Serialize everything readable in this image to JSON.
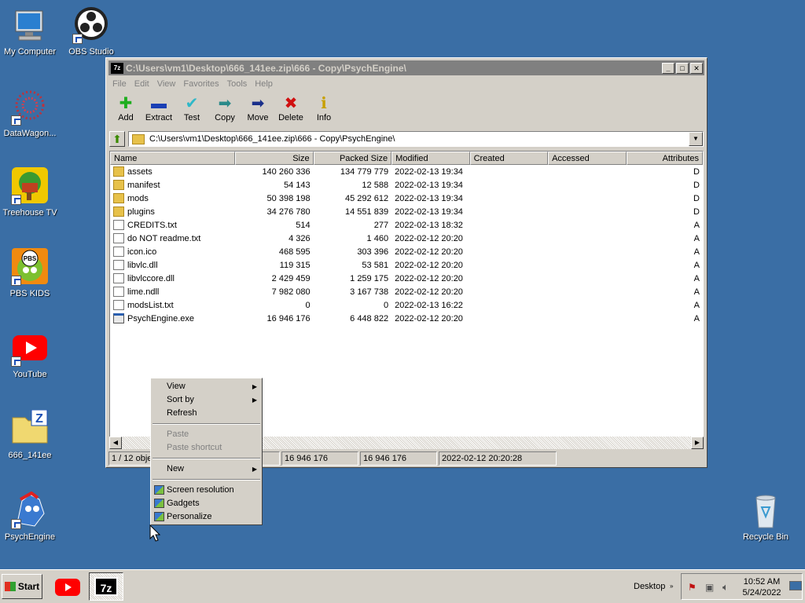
{
  "desktop": {
    "icons": [
      {
        "label": "My Computer"
      },
      {
        "label": "OBS Studio"
      },
      {
        "label": "DataWagon..."
      },
      {
        "label": "Treehouse TV"
      },
      {
        "label": "PBS KIDS"
      },
      {
        "label": "YouTube"
      },
      {
        "label": "666_141ee"
      },
      {
        "label": "PsychEngine"
      },
      {
        "label": "Recycle Bin"
      }
    ]
  },
  "window": {
    "title": "C:\\Users\\vm1\\Desktop\\666_141ee.zip\\666 - Copy\\PsychEngine\\",
    "app_icon": "7z",
    "menu": [
      "File",
      "Edit",
      "View",
      "Favorites",
      "Tools",
      "Help"
    ],
    "toolbar": [
      {
        "label": "Add",
        "icon": "plus-icon",
        "glyph": "✚",
        "color": "#1fae1f"
      },
      {
        "label": "Extract",
        "icon": "minus-icon",
        "glyph": "▬",
        "color": "#1a3fb5"
      },
      {
        "label": "Test",
        "icon": "check-icon",
        "glyph": "✔",
        "color": "#2fb8c8"
      },
      {
        "label": "Copy",
        "icon": "copy-arrow-icon",
        "glyph": "➡",
        "color": "#2a8a8a"
      },
      {
        "label": "Move",
        "icon": "move-arrow-icon",
        "glyph": "➡",
        "color": "#1a2f8a"
      },
      {
        "label": "Delete",
        "icon": "delete-x-icon",
        "glyph": "✖",
        "color": "#d01010"
      },
      {
        "label": "Info",
        "icon": "info-icon",
        "glyph": "ℹ",
        "color": "#c8a000"
      }
    ],
    "address": "C:\\Users\\vm1\\Desktop\\666_141ee.zip\\666 - Copy\\PsychEngine\\",
    "columns": [
      "Name",
      "Size",
      "Packed Size",
      "Modified",
      "Created",
      "Accessed",
      "Attributes"
    ],
    "files": [
      {
        "name": "assets",
        "type": "folder",
        "size": "140 260 336",
        "packed": "134 779 779",
        "modified": "2022-02-13 19:34",
        "attr": "D"
      },
      {
        "name": "manifest",
        "type": "folder",
        "size": "54 143",
        "packed": "12 588",
        "modified": "2022-02-13 19:34",
        "attr": "D"
      },
      {
        "name": "mods",
        "type": "folder",
        "size": "50 398 198",
        "packed": "45 292 612",
        "modified": "2022-02-13 19:34",
        "attr": "D"
      },
      {
        "name": "plugins",
        "type": "folder",
        "size": "34 276 780",
        "packed": "14 551 839",
        "modified": "2022-02-13 19:34",
        "attr": "D"
      },
      {
        "name": "CREDITS.txt",
        "type": "file",
        "size": "514",
        "packed": "277",
        "modified": "2022-02-13 18:32",
        "attr": "A"
      },
      {
        "name": "do NOT readme.txt",
        "type": "file",
        "size": "4 326",
        "packed": "1 460",
        "modified": "2022-02-12 20:20",
        "attr": "A"
      },
      {
        "name": "icon.ico",
        "type": "file",
        "size": "468 595",
        "packed": "303 396",
        "modified": "2022-02-12 20:20",
        "attr": "A"
      },
      {
        "name": "libvlc.dll",
        "type": "file",
        "size": "119 315",
        "packed": "53 581",
        "modified": "2022-02-12 20:20",
        "attr": "A"
      },
      {
        "name": "libvlccore.dll",
        "type": "file",
        "size": "2 429 459",
        "packed": "1 259 175",
        "modified": "2022-02-12 20:20",
        "attr": "A"
      },
      {
        "name": "lime.ndll",
        "type": "file",
        "size": "7 982 080",
        "packed": "3 167 738",
        "modified": "2022-02-12 20:20",
        "attr": "A"
      },
      {
        "name": "modsList.txt",
        "type": "file",
        "size": "0",
        "packed": "0",
        "modified": "2022-02-13 16:22",
        "attr": "A"
      },
      {
        "name": "PsychEngine.exe",
        "type": "exe",
        "size": "16 946 176",
        "packed": "6 448 822",
        "modified": "2022-02-12 20:20",
        "attr": "A"
      }
    ],
    "status": [
      "1 / 12 obje",
      "16 946 176",
      "16 946 176",
      "2022-02-12 20:20:28"
    ]
  },
  "context_menu": {
    "items": [
      {
        "label": "View",
        "submenu": true
      },
      {
        "label": "Sort by",
        "submenu": true
      },
      {
        "label": "Refresh"
      },
      {
        "sep": true
      },
      {
        "label": "Paste",
        "disabled": true
      },
      {
        "label": "Paste shortcut",
        "disabled": true
      },
      {
        "sep": true
      },
      {
        "label": "New",
        "submenu": true
      },
      {
        "sep": true
      },
      {
        "label": "Screen resolution",
        "icon": "screen-resolution-icon"
      },
      {
        "label": "Gadgets",
        "icon": "gadgets-icon"
      },
      {
        "label": "Personalize",
        "icon": "personalize-icon"
      }
    ]
  },
  "taskbar": {
    "start_label": "Start",
    "desktop_label": "Desktop",
    "time": "10:52 AM",
    "date": "5/24/2022"
  }
}
